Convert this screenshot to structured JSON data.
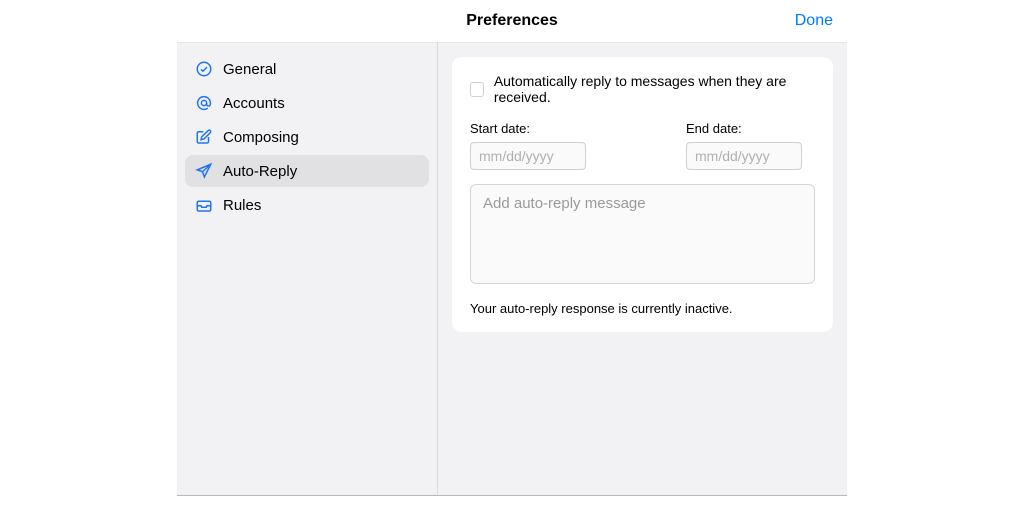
{
  "header": {
    "title": "Preferences",
    "done_label": "Done"
  },
  "sidebar": {
    "items": [
      {
        "label": "General",
        "icon": "checkmark-circle-icon"
      },
      {
        "label": "Accounts",
        "icon": "at-icon"
      },
      {
        "label": "Composing",
        "icon": "compose-icon"
      },
      {
        "label": "Auto-Reply",
        "icon": "airplane-icon"
      },
      {
        "label": "Rules",
        "icon": "tray-rules-icon"
      }
    ],
    "selected_index": 3,
    "icon_color": "#1e74f4"
  },
  "main": {
    "auto_reply": {
      "checkbox_label": "Automatically reply to messages when they are received.",
      "checkbox_checked": false,
      "start_date_label": "Start date:",
      "start_date_placeholder": "mm/dd/yyyy",
      "start_date_value": "",
      "end_date_label": "End date:",
      "end_date_placeholder": "mm/dd/yyyy",
      "end_date_value": "",
      "message_placeholder": "Add auto-reply message",
      "message_value": "",
      "status_text": "Your auto-reply response is currently inactive."
    }
  }
}
